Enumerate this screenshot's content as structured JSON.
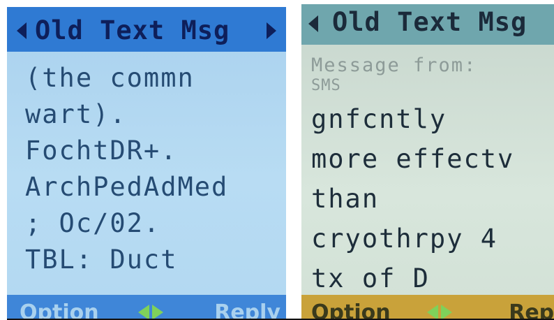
{
  "left_screen": {
    "title": "Old Text Msg",
    "lines": [
      "(the commn",
      "wart).",
      "FochtDR+.",
      "ArchPedAdMed",
      "; Oc/02.",
      "TBL: Duct"
    ],
    "soft_left": "Option",
    "soft_right": "Reply"
  },
  "right_screen": {
    "title": "Old Text Msg",
    "header": "Message from:",
    "sender": "SMS",
    "lines": [
      "gnfcntly",
      "more effectv",
      "than",
      "cryothrpy 4",
      "tx of D"
    ],
    "soft_left": "Option",
    "soft_right": "Reply"
  },
  "colors": {
    "left_title_bar": "#2f7ad3",
    "left_background": "#b2d8f2",
    "right_title_bar": "#6fa6ad",
    "right_background": "#d2e1d6",
    "nav_arrow": "#7fd15a"
  },
  "icons": [
    "left-arrow-icon",
    "right-arrow-icon",
    "nav-arrows-icon"
  ]
}
